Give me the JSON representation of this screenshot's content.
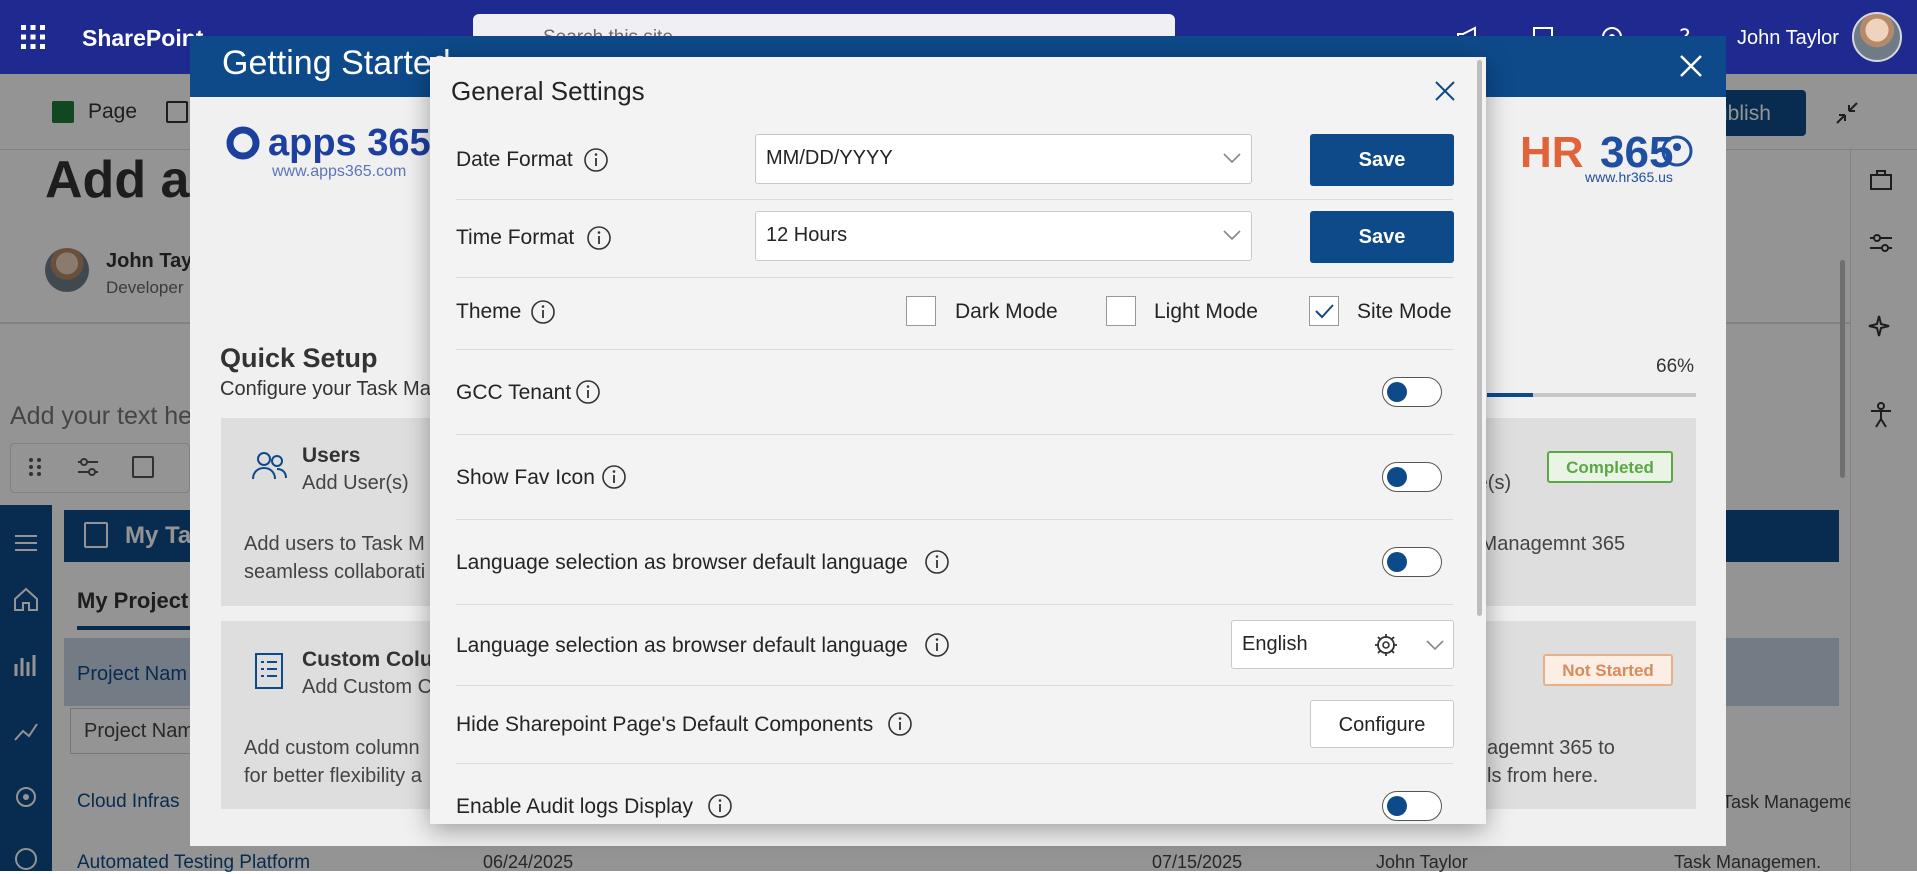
{
  "suite": {
    "brand": "SharePoint",
    "search_placeholder": "Search this site",
    "user_name": "John Taylor"
  },
  "page": {
    "page_label": "Page",
    "publish_label": "ublish",
    "title_fragment": "Add a",
    "author_name": "John Tay",
    "author_role": "Developer",
    "add_text_placeholder": "Add your text he",
    "my_tasks_title": "My Ta",
    "my_projects_tab": "My Project",
    "project_name_header": "Project Nam",
    "project_name_filter": "Project Nam",
    "rows": [
      {
        "name": "Cloud Infras",
        "app": "Task Managemen."
      },
      {
        "name": "Automated Testing Platform",
        "start": "06/24/2025",
        "end": "07/15/2025",
        "owner": "John Taylor",
        "app": "Task Managemen."
      }
    ]
  },
  "getting_started": {
    "title": "Getting Started",
    "apps365_logo": "apps 365",
    "apps365_url": "www.apps365.com",
    "hr365_logo_a": "HR",
    "hr365_logo_b": "365",
    "hr365_url": "www.hr365.us",
    "quick_setup_title": "Quick Setup",
    "quick_setup_sub": "Configure your Task Ma",
    "progress_text": "66%",
    "progress_value": 0.66,
    "cards": [
      {
        "title": "Users",
        "subtitle": "Add User(s)",
        "desc_line1": "Add users to Task M",
        "desc_line2": "seamless collaborati",
        "right_sub": "ate(s)",
        "right_desc": "k Managemnt 365",
        "status": "Completed"
      },
      {
        "title": "Custom Colu",
        "subtitle": "Add Custom C",
        "desc_line1": "Add custom column",
        "desc_line2": "for better flexibility a",
        "right_desc_line1": "agemnt 365 to",
        "right_desc_line2": "ls from here.",
        "status": "Not Started"
      }
    ]
  },
  "general_settings": {
    "title": "General Settings",
    "date_format": {
      "label": "Date Format",
      "value": "MM/DD/YYYY",
      "save_label": "Save"
    },
    "time_format": {
      "label": "Time Format",
      "value": "12 Hours",
      "save_label": "Save"
    },
    "theme": {
      "label": "Theme",
      "options": [
        {
          "label": "Dark Mode",
          "checked": false
        },
        {
          "label": "Light Mode",
          "checked": false
        },
        {
          "label": "Site Mode",
          "checked": true
        }
      ]
    },
    "gcc_tenant": {
      "label": "GCC Tenant",
      "on": false
    },
    "show_fav_icon": {
      "label": "Show Fav Icon",
      "on": false
    },
    "lang_browser_toggle": {
      "label": "Language selection as browser default language",
      "on": false
    },
    "lang_browser_select": {
      "label": "Language selection as browser default language",
      "value": "English"
    },
    "hide_sp_components": {
      "label": "Hide Sharepoint Page's Default Components",
      "button_label": "Configure"
    },
    "audit_logs": {
      "label": "Enable Audit logs Display",
      "on": false
    }
  },
  "colors": {
    "primary": "#0e4a8a",
    "suite_bar": "#1e2a8f",
    "completed": "#5aa843",
    "not_started": "#d98a5a"
  }
}
